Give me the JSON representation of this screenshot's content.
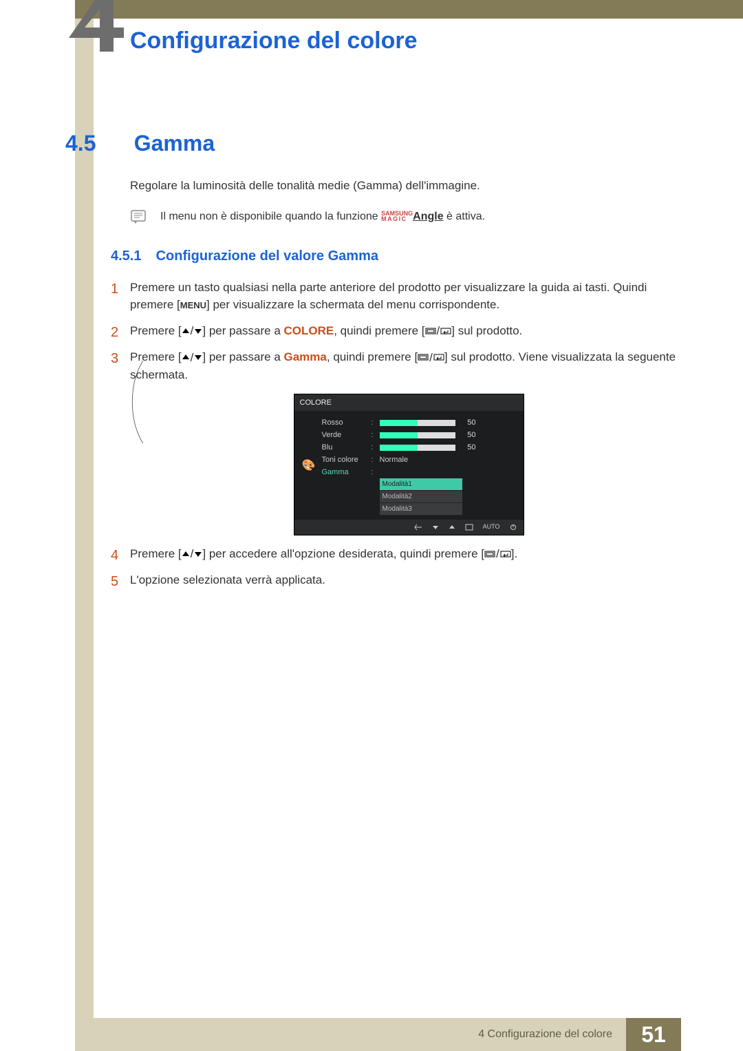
{
  "chapter": {
    "number_glyph": "4",
    "title": "Configurazione del colore"
  },
  "section": {
    "number": "4.5",
    "title": "Gamma"
  },
  "intro": "Regolare la luminosità delle tonalità medie (Gamma) dell'immagine.",
  "note": {
    "pre": "Il menu non è disponibile quando la funzione ",
    "brand_top": "SAMSUNG",
    "brand_bottom": "MAGIC",
    "angle": "Angle",
    "post": " è attiva."
  },
  "subsection": {
    "number": "4.5.1",
    "title": "Configurazione del valore Gamma"
  },
  "steps": {
    "s1a": "Premere un tasto qualsiasi nella parte anteriore del prodotto per visualizzare la guida ai tasti. Quindi premere [",
    "s1_menu": "MENU",
    "s1b": "] per visualizzare la schermata del menu corrispondente.",
    "s2a": "Premere [",
    "s2b": "] per passare a ",
    "s2_hl": "COLORE",
    "s2c": ", quindi premere [",
    "s2d": "] sul prodotto.",
    "s3a": "Premere [",
    "s3b": "] per passare a ",
    "s3_hl": "Gamma",
    "s3c": ", quindi premere [",
    "s3d": "] sul prodotto. Viene visualizzata la seguente schermata.",
    "s4a": "Premere [",
    "s4b": "] per accedere all'opzione desiderata, quindi premere [",
    "s4c": "].",
    "s5": "L'opzione selezionata verrà applicata."
  },
  "osd": {
    "title": "COLORE",
    "rows": {
      "rosso": {
        "label": "Rosso",
        "value": "50",
        "fill": 50
      },
      "verde": {
        "label": "Verde",
        "value": "50",
        "fill": 50
      },
      "blu": {
        "label": "Blu",
        "value": "50",
        "fill": 50
      },
      "toni": {
        "label": "Toni colore",
        "value": "Normale"
      },
      "gamma": {
        "label": "Gamma"
      }
    },
    "options": [
      "Modalità1",
      "Modalità2",
      "Modalità3"
    ],
    "footer_auto": "AUTO"
  },
  "footer": {
    "text": "4 Configurazione del colore",
    "page": "51"
  }
}
